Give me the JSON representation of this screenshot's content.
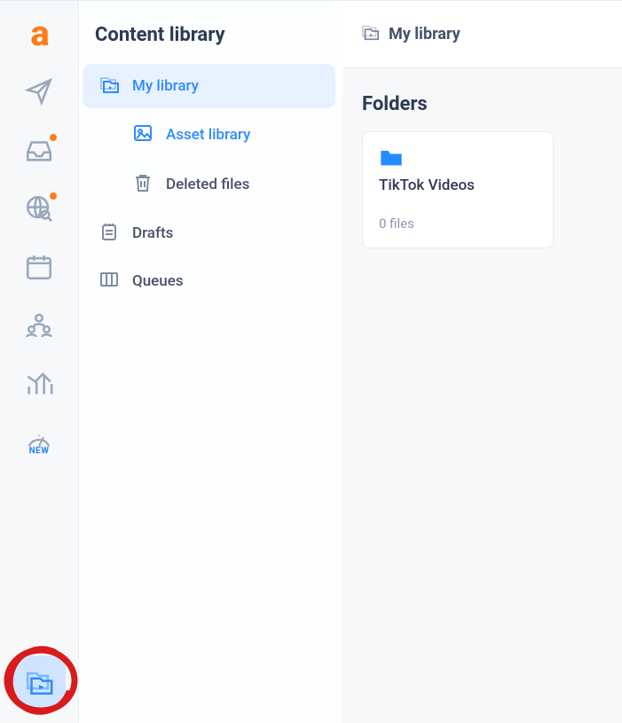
{
  "rail": {
    "logo_letter": "a",
    "gauge_tag": "NEW"
  },
  "nav": {
    "title": "Content library",
    "my_library": "My library",
    "asset_library": "Asset library",
    "deleted_files": "Deleted files",
    "drafts": "Drafts",
    "queues": "Queues"
  },
  "main": {
    "breadcrumb": "My library",
    "folders_heading": "Folders",
    "folders": [
      {
        "name": "TikTok Videos",
        "count": "0 files"
      }
    ]
  }
}
